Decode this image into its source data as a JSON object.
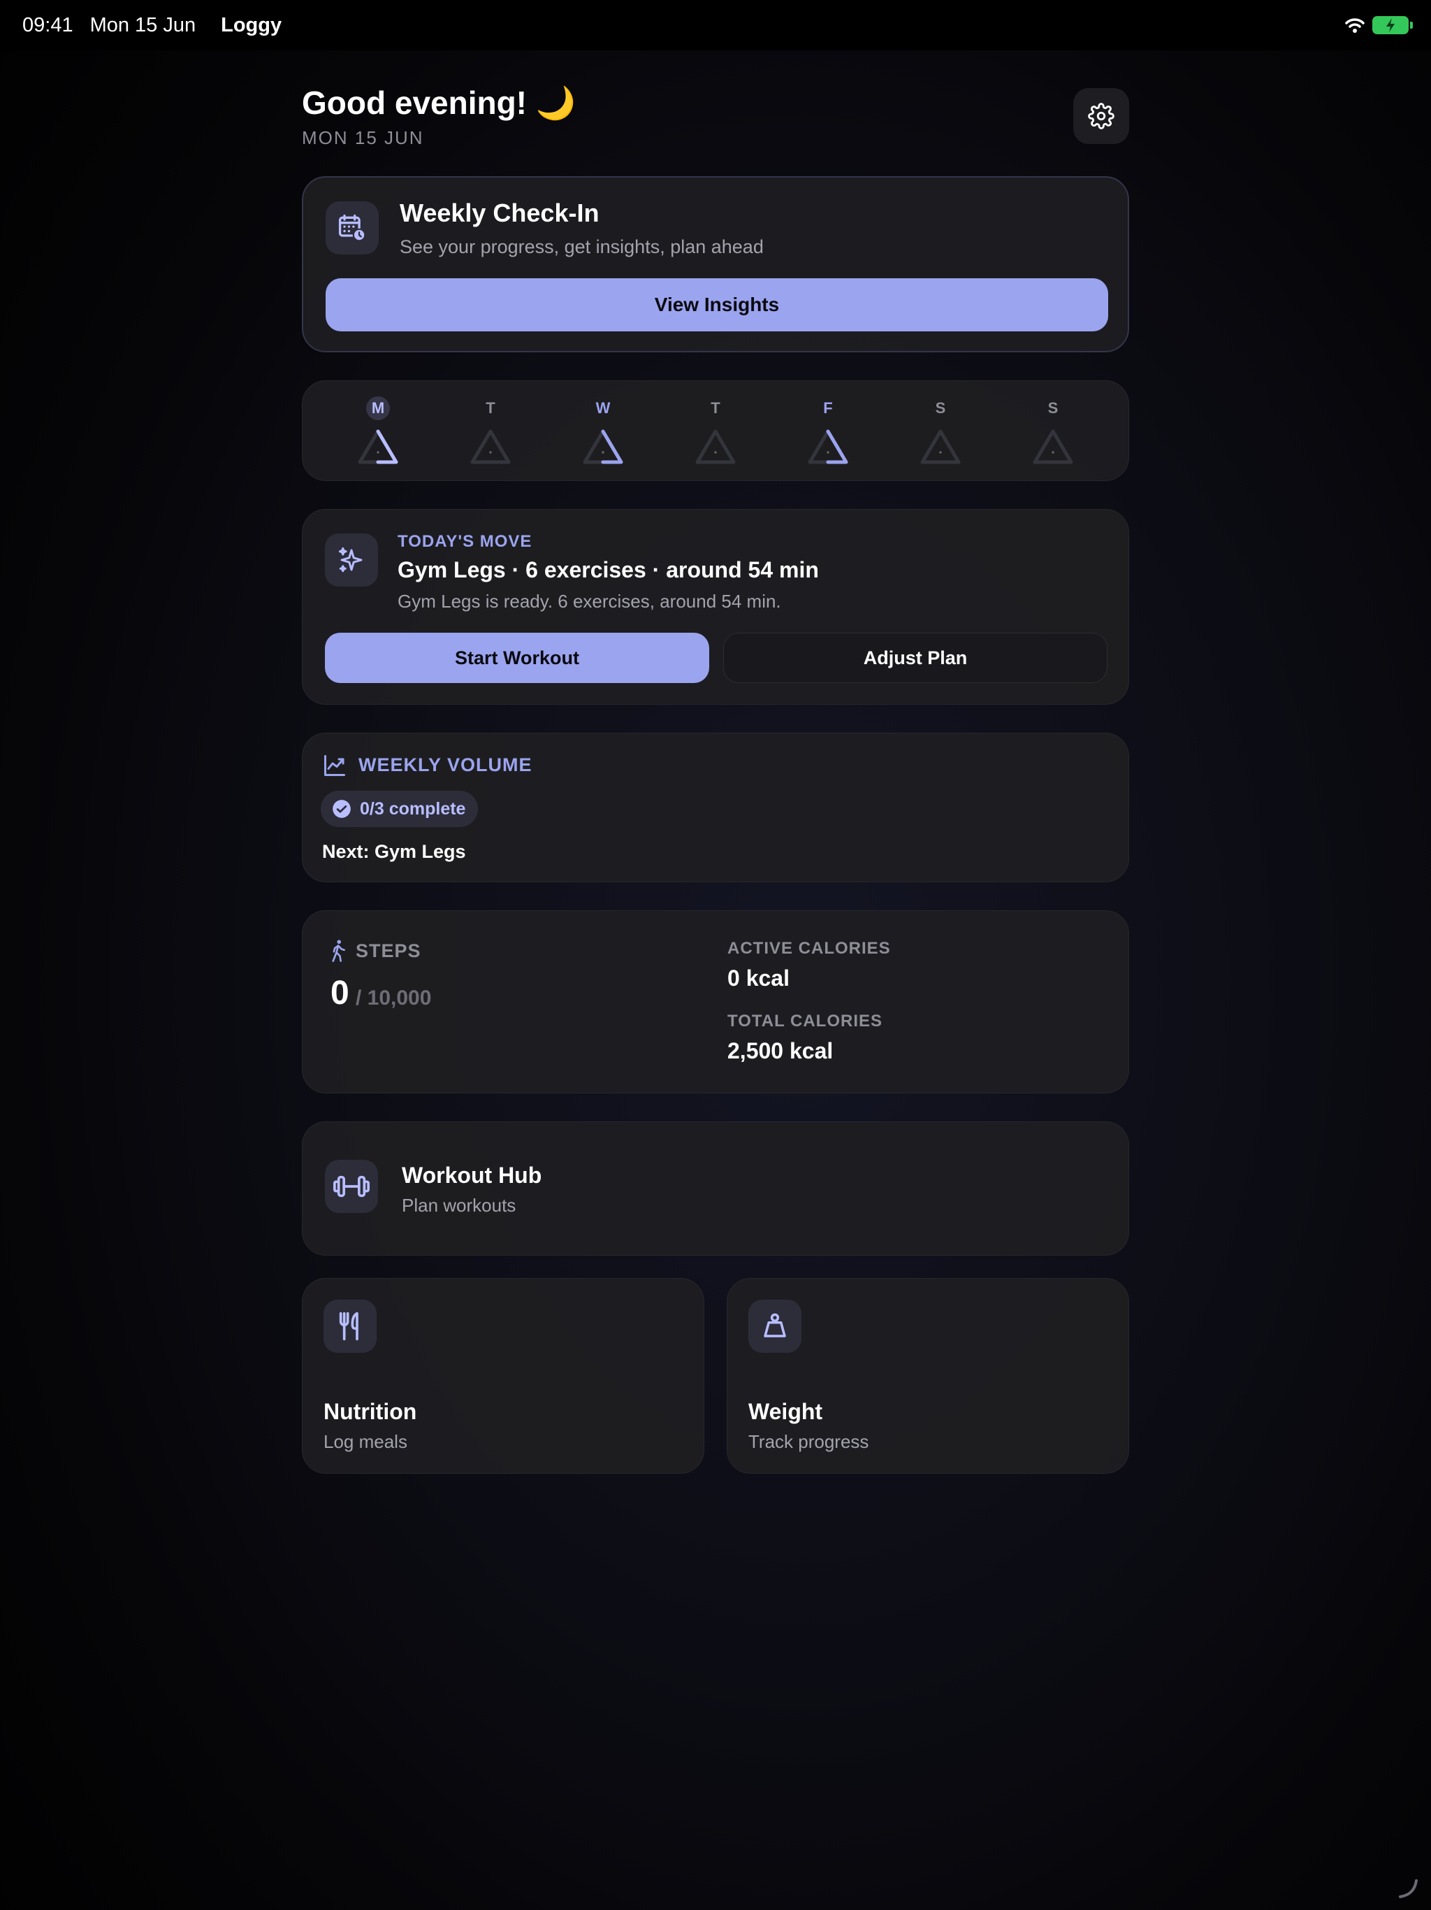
{
  "status_bar": {
    "time": "09:41",
    "date": "Mon 15 Jun",
    "app_name": "Loggy",
    "battery_color": "#34c759"
  },
  "header": {
    "greeting": "Good evening! 🌙",
    "date": "MON 15 JUN",
    "settings_icon": "gear-icon"
  },
  "checkin": {
    "icon": "calendar-clock-icon",
    "title": "Weekly Check-In",
    "subtitle": "See your progress, get insights, plan ahead",
    "button_label": "View Insights"
  },
  "week": {
    "days": [
      {
        "label": "M",
        "state": "today",
        "progress": 0.5
      },
      {
        "label": "T",
        "state": "rest",
        "progress": 0
      },
      {
        "label": "W",
        "state": "planned",
        "progress": 0.5
      },
      {
        "label": "T",
        "state": "rest",
        "progress": 0
      },
      {
        "label": "F",
        "state": "planned",
        "progress": 0.5
      },
      {
        "label": "S",
        "state": "rest",
        "progress": 0
      },
      {
        "label": "S",
        "state": "rest",
        "progress": 0
      }
    ]
  },
  "todays_move": {
    "icon": "sparkles-icon",
    "eyebrow": "TODAY'S MOVE",
    "title": "Gym Legs · 6 exercises · around 54 min",
    "description": "Gym Legs is ready. 6 exercises, around 54 min.",
    "start_label": "Start Workout",
    "adjust_label": "Adjust Plan"
  },
  "weekly_volume": {
    "icon": "chart-line-icon",
    "eyebrow": "WEEKLY VOLUME",
    "badge": "0/3 complete",
    "next": "Next: Gym Legs"
  },
  "activity": {
    "steps_label": "STEPS",
    "steps_value": "0",
    "steps_goal": "/ 10,000",
    "active_calories_label": "ACTIVE CALORIES",
    "active_calories_value": "0 kcal",
    "total_calories_label": "TOTAL CALORIES",
    "total_calories_value": "2,500 kcal"
  },
  "workout_hub": {
    "icon": "dumbbell-icon",
    "title": "Workout Hub",
    "subtitle": "Plan workouts"
  },
  "nutrition": {
    "icon": "fork-knife-icon",
    "title": "Nutrition",
    "subtitle": "Log meals"
  },
  "weight": {
    "icon": "scale-weight-icon",
    "title": "Weight",
    "subtitle": "Track progress"
  },
  "colors": {
    "accent": "#9ba4ee",
    "card": "#1e1e22",
    "background": "#0c0c14"
  }
}
